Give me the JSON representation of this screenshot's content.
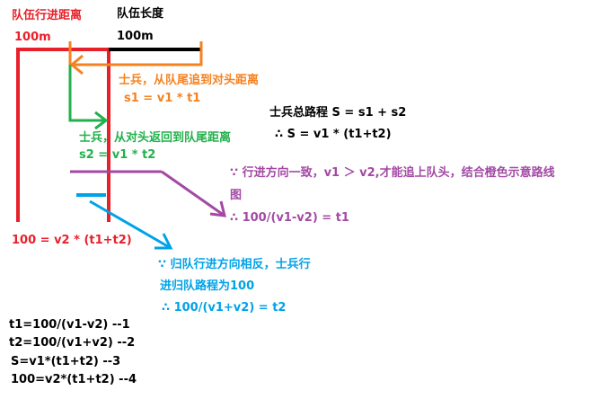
{
  "labels": {
    "march_distance": "队伍行进距离",
    "team_length": "队伍长度",
    "march_value": "100m",
    "length_value": "100m",
    "orange_label": "士兵，从队尾追到对头距离",
    "orange_eq": "s1 = v1 * t1",
    "total_label": "士兵总路程 S = s1 + s2",
    "total_eq": "∴ S = v1 * (t1+t2)",
    "green_label": "士兵，从对头返回到队尾距离",
    "green_eq": "s2 = v1 * t2",
    "purple_note_1": "∵ 行进方向一致，v1 ＞ v2,才能追上队头，结合橙色示意路线",
    "purple_note_2": "图",
    "purple_eq": "∴ 100/(v1-v2) = t1",
    "red_eq": "100 = v2 * (t1+t2)",
    "blue_note_1": "∵ 归队行进方向相反，士兵行",
    "blue_note_2": "进归队路程为100",
    "blue_eq": "∴ 100/(v1+v2)  = t2",
    "eq1": "t1=100/(v1-v2) --1",
    "eq2": "t2=100/(v1+v2) --2",
    "eq3": "S=v1*(t1+t2) --3",
    "eq4": "100=v2*(t1+t2) --4"
  },
  "colors": {
    "red": "#e8202a",
    "black": "#000000",
    "orange": "#f58220",
    "green": "#22b14c",
    "purple": "#a349a4",
    "blue": "#00a2e8"
  }
}
